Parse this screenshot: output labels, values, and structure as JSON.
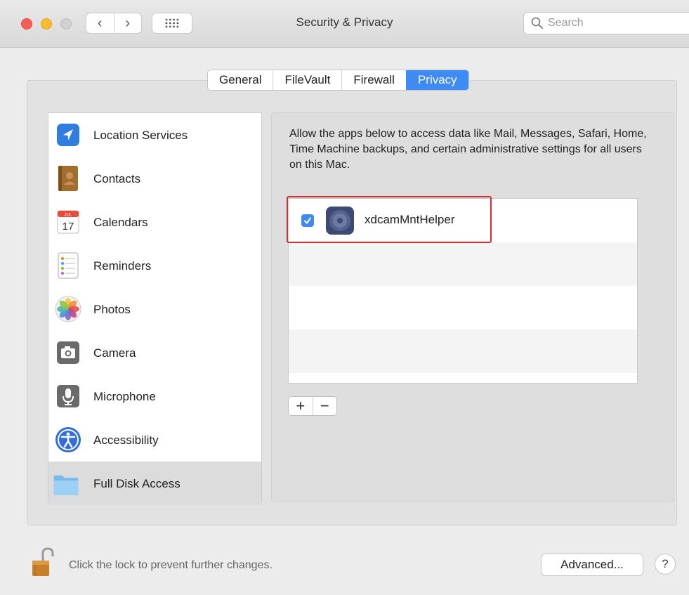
{
  "window": {
    "title": "Security & Privacy"
  },
  "toolbar": {
    "back_label": "‹",
    "forward_label": "›",
    "search_placeholder": "Search"
  },
  "tabs": [
    {
      "label": "General",
      "active": false
    },
    {
      "label": "FileVault",
      "active": false
    },
    {
      "label": "Firewall",
      "active": false
    },
    {
      "label": "Privacy",
      "active": true
    }
  ],
  "sidebar": {
    "items": [
      {
        "label": "Location Services",
        "icon": "location-arrow-icon"
      },
      {
        "label": "Contacts",
        "icon": "contacts-book-icon"
      },
      {
        "label": "Calendars",
        "icon": "calendar-icon",
        "icon_text_month": "JUL",
        "icon_text_day": "17"
      },
      {
        "label": "Reminders",
        "icon": "reminders-list-icon"
      },
      {
        "label": "Photos",
        "icon": "photos-flower-icon"
      },
      {
        "label": "Camera",
        "icon": "camera-icon"
      },
      {
        "label": "Microphone",
        "icon": "microphone-icon"
      },
      {
        "label": "Accessibility",
        "icon": "accessibility-icon"
      },
      {
        "label": "Full Disk Access",
        "icon": "folder-icon",
        "selected": true
      }
    ]
  },
  "main": {
    "description": "Allow the apps below to access data like Mail, Messages, Safari, Home, Time Machine backups, and certain administrative settings for all users on this Mac.",
    "apps": [
      {
        "name": "xdcamMntHelper",
        "checked": true,
        "icon": "disk-app-icon"
      }
    ],
    "add_label": "+",
    "remove_label": "−"
  },
  "footer": {
    "lock_message": "Click the lock to prevent further changes.",
    "advanced_label": "Advanced...",
    "help_label": "?"
  },
  "colors": {
    "accent": "#3f8bf5",
    "highlight_border": "#d03030"
  }
}
